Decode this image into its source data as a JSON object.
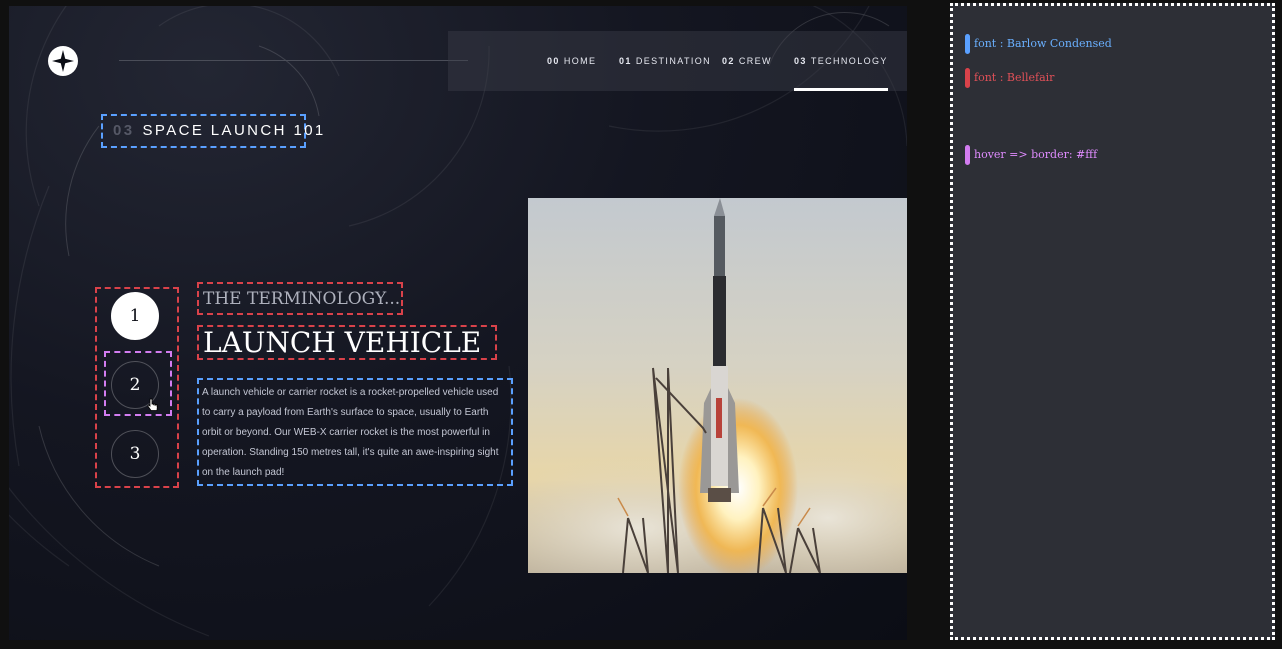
{
  "brand": {
    "logo_icon": "star-icon"
  },
  "nav": {
    "items": [
      {
        "num": "00",
        "label": "HOME"
      },
      {
        "num": "01",
        "label": "DESTINATION"
      },
      {
        "num": "02",
        "label": "CREW"
      },
      {
        "num": "03",
        "label": "TECHNOLOGY"
      }
    ],
    "active_index": 3
  },
  "page": {
    "heading_num": "03",
    "heading_text": "SPACE LAUNCH 101"
  },
  "selector": {
    "steps": [
      "1",
      "2",
      "3"
    ],
    "active": "1",
    "hovered": "2"
  },
  "content": {
    "subheading": "THE TERMINOLOGY...",
    "title": "LAUNCH VEHICLE",
    "description": "A launch vehicle or carrier rocket is a rocket-propelled vehicle used to carry a payload from Earth's surface to space, usually to Earth orbit or beyond. Our WEB-X carrier rocket is the most powerful in operation. Standing 150 metres tall, it's quite an awe-inspiring sight on the launch pad!"
  },
  "notes": [
    {
      "text": "font : Barlow Condensed",
      "color": "#5aa0ff"
    },
    {
      "text": "font : Bellefair",
      "color": "#d9424a"
    },
    {
      "text": "hover => border: #fff",
      "color": "#d27cf0"
    }
  ],
  "colors": {
    "background": "#0b0d15",
    "accent_blue": "#5aa0ff",
    "accent_red": "#d9424a",
    "accent_purple": "#d27cf0"
  }
}
